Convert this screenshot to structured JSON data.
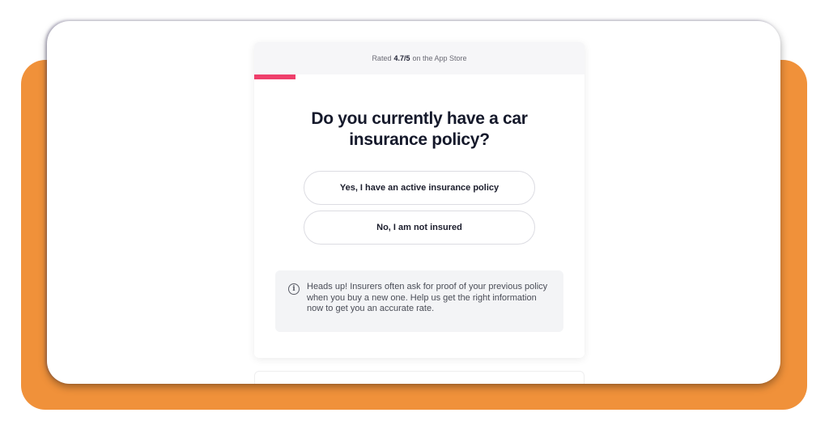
{
  "header": {
    "rating_prefix": "Rated",
    "rating_value": "4.7/5",
    "rating_suffix": "on the App Store"
  },
  "progress": {
    "fraction": 0.125
  },
  "question": {
    "title": "Do you currently have a car insurance policy?"
  },
  "options": [
    {
      "label": "Yes, I have an active insurance policy"
    },
    {
      "label": "No, I am not insured"
    }
  ],
  "notice": {
    "icon": "info-icon",
    "text": "Heads up! Insurers often ask for proof of your previous policy when you buy a new one. Help us get the right information now to get you an accurate rate."
  },
  "colors": {
    "accent": "#ef3f6b",
    "backdrop": "#f0913a",
    "heading": "#15192b"
  }
}
